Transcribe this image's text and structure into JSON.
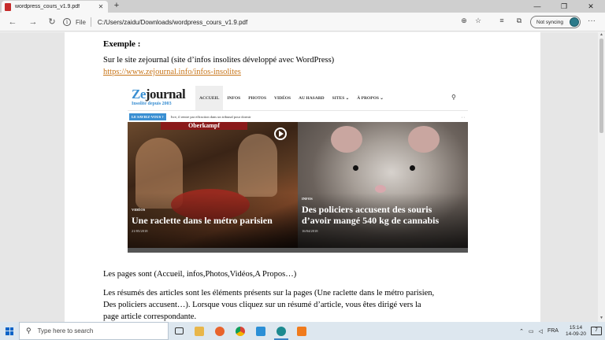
{
  "browser": {
    "tab_title": "wordpress_cours_v1.9.pdf",
    "tab_close": "✕",
    "new_tab": "+",
    "window_controls": [
      "—",
      "❐",
      "✕"
    ],
    "back": "←",
    "forward": "→",
    "refresh": "↻",
    "info_glyph": "i",
    "file_label": "File",
    "url": "C:/Users/zaidu/Downloads/wordpress_cours_v1.9.pdf",
    "sync_label": "Not syncing",
    "more": "···"
  },
  "document": {
    "heading": "Exemple :",
    "line1": "Sur le site zejournal (site d’infos insolites développé avec WordPress)",
    "link": "https://www.zejournal.info/infos-insolites",
    "para1": "Les pages sont (Accueil, infos,Photos,Vidéos,A Propos…)",
    "para2_l1": "Les résumés des articles sont les éléments présents sur la pages (Une raclette dans le métro parisien,",
    "para2_l2": "Des policiers accusent…). Lorsque vous cliquez sur un résumé d’article, vous êtes dirigé vers la",
    "para2_l3": "page article correspondante."
  },
  "site": {
    "logo_ze": "Ze",
    "logo_rest": "journal",
    "logo_sub": "Insolite depuis 2003",
    "nav": [
      "ACCUEIL",
      "INFOS",
      "PHOTOS",
      "VIDÉOS",
      "AU HASARD",
      "SITES ⌄",
      "À PROPOS ⌄"
    ],
    "ticker_badge": "LE SAVIEZ-VOUS ?",
    "ticker_text": "Ivre, il rentre par effraction dans un tribunal pour dormir",
    "ticker_ctrl": "‹ ›",
    "sign": "Oberkampf",
    "card1_cat": "VIDÉOS",
    "card1_headline": "Une raclette dans le métro parisien",
    "card1_date": "21/05/2018",
    "card2_cat": "INFOS",
    "card2_headline": "Des policiers accusent des souris d’avoir mangé 540 kg de cannabis",
    "card2_date": "16/04/2018"
  },
  "taskbar": {
    "search_placeholder": "Type here to search",
    "language": "FRA",
    "time": "15:14",
    "date": "14-09-20",
    "notif_count": "7"
  }
}
